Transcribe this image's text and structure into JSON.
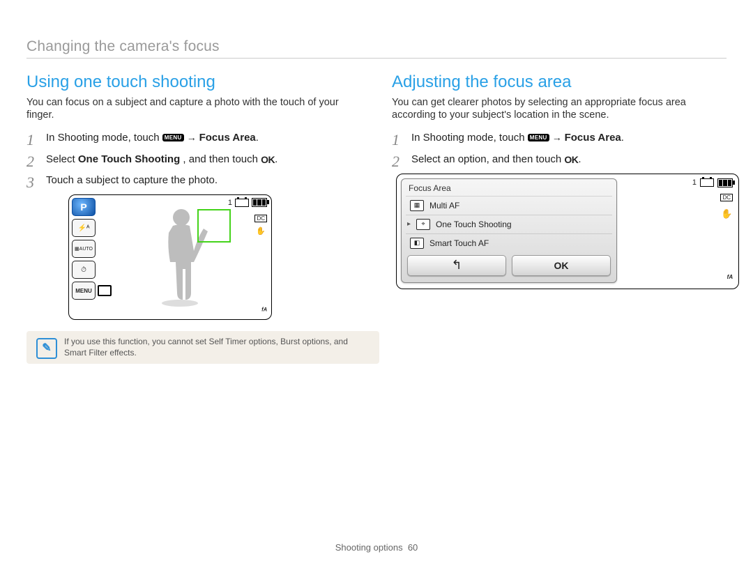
{
  "breadcrumb": "Changing the camera's focus",
  "left": {
    "title": "Using one touch shooting",
    "intro": "You can focus on a subject and capture a photo with the touch of your finger.",
    "steps": {
      "s1_pre": "In Shooting mode, touch ",
      "s1_conn": " → ",
      "s1_bold": "Focus Area",
      "s1_post": ".",
      "s2_pre": "Select ",
      "s2_bold": "One Touch Shooting",
      "s2_mid": ", and then touch ",
      "s2_post": ".",
      "s3": "Touch a subject to capture the photo."
    }
  },
  "right": {
    "title": "Adjusting the focus area",
    "intro": "You can get clearer photos by selecting an appropriate focus area according to your subject's location in the scene.",
    "steps": {
      "s1_pre": "In Shooting mode, touch ",
      "s1_conn": " → ",
      "s1_bold": "Focus Area",
      "s1_post": ".",
      "s2_pre": "Select an option, and then touch ",
      "s2_post": "."
    }
  },
  "ui_tokens": {
    "menu_badge": "MENU",
    "ok_badge": "OK"
  },
  "camera_shot": {
    "mode_letter": "P",
    "remaining": "1",
    "left_icons": {
      "flash": "flash-auto",
      "wb": "awAUTO",
      "timer": "self-timer"
    },
    "right_icons": {
      "dc": "DC",
      "ois": "OIS"
    },
    "bottom_right": "ᶠᴬ"
  },
  "menu_shot": {
    "panel_title": "Focus Area",
    "rows": [
      {
        "label": "Multi AF",
        "selected": false,
        "icon": "grid"
      },
      {
        "label": "One Touch Shooting",
        "selected": true,
        "icon": "crosshair"
      },
      {
        "label": "Smart Touch AF",
        "selected": false,
        "icon": "smart"
      }
    ],
    "buttons": {
      "back": "↰",
      "ok": "OK"
    },
    "top_remaining": "1",
    "right_icons": {
      "dc": "DC",
      "ois": "OIS"
    },
    "bottom_right": "ᶠᴬ"
  },
  "note": "If you use this function, you cannot set Self Timer options, Burst options, and Smart Filter effects.",
  "footer": {
    "label": "Shooting options",
    "page": "60"
  }
}
